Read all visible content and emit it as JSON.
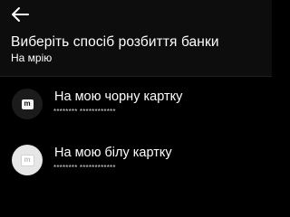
{
  "header": {
    "back_icon": "arrow-left-icon",
    "title": "Виберіть спосіб розбиття банки",
    "subtitle": "На мрію"
  },
  "cards": [
    {
      "label": "На мою чорну картку",
      "masked_number": "******** ************",
      "icon": "black-card-icon",
      "logo_letter": "m",
      "icon_bg": "#1b1b1b"
    },
    {
      "label": "На мою білу картку",
      "masked_number": "******** ************",
      "icon": "white-card-icon",
      "logo_letter": "m",
      "icon_bg": "#e6e6e6"
    }
  ],
  "colors": {
    "background": "#000000",
    "header_background": "#0d0d0d",
    "text": "#ffffff"
  }
}
